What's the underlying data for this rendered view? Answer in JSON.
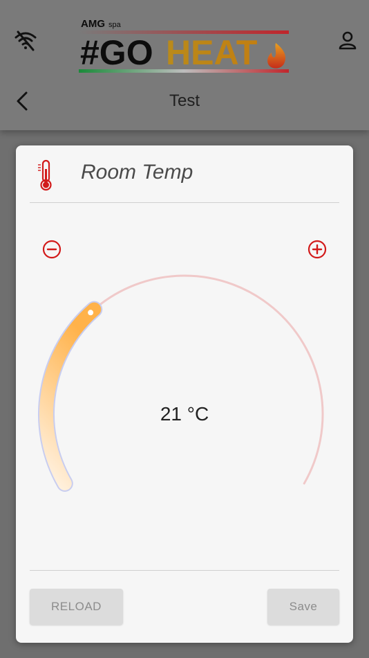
{
  "header": {
    "title": "Test",
    "logo": {
      "company": "AMG",
      "suffix": "spa",
      "brand_hash_go": "#GO",
      "brand_heat": "HEAT"
    },
    "icons": [
      "wifi-off-icon",
      "user-icon",
      "back-arrow-icon"
    ]
  },
  "card": {
    "title": "Room Temp",
    "icon": "thermometer-icon",
    "dial": {
      "value": 21,
      "unit": "°C",
      "display": "21 °C",
      "fill_fraction": 0.33
    },
    "controls": {
      "decrease_icon": "minus-circle-icon",
      "increase_icon": "plus-circle-icon"
    },
    "buttons": {
      "reload_label": "RELOAD",
      "save_label": "Save"
    }
  },
  "colors": {
    "accent_red": "#d21a1a",
    "dial_track": "#f0c9c9",
    "dial_fill_start": "#ffb24a",
    "dial_fill_end": "#fff4e6",
    "button_bg": "#dcdcdc"
  }
}
